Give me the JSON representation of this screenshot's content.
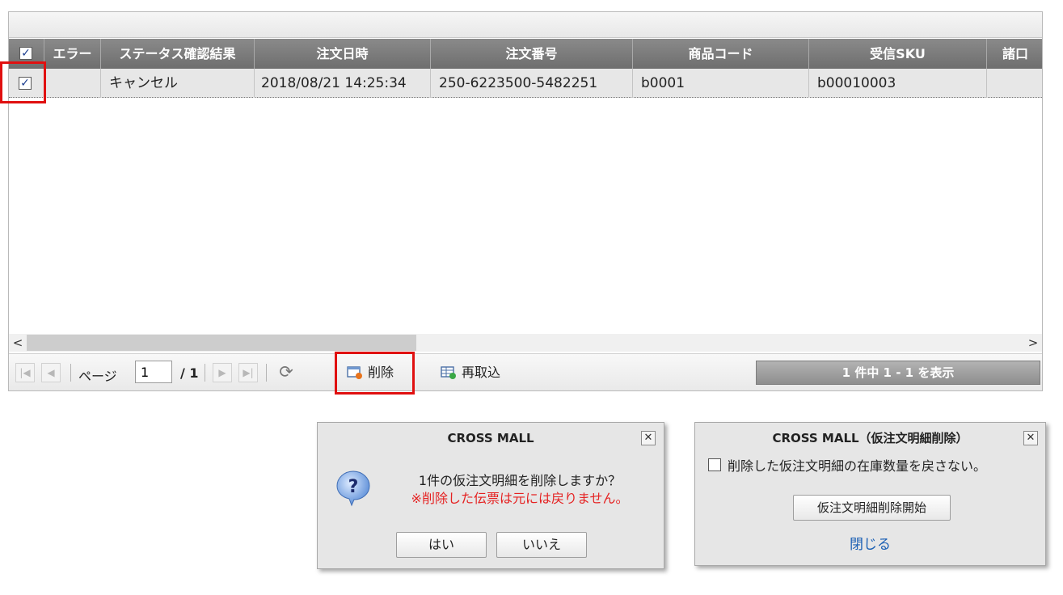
{
  "grid": {
    "columns": [
      {
        "label": ""
      },
      {
        "label": "エラー"
      },
      {
        "label": "ステータス確認結果"
      },
      {
        "label": "注文日時"
      },
      {
        "label": "注文番号"
      },
      {
        "label": "商品コード"
      },
      {
        "label": "受信SKU"
      },
      {
        "label": "諸口"
      }
    ],
    "header_checkbox": "✓",
    "rows": [
      {
        "checkbox": "✓",
        "error": "",
        "status": "キャンセル",
        "order_datetime": "2018/08/21 14:25:34",
        "order_number": "250-6223500-5482251",
        "product_code": "b0001",
        "received_sku": "b00010003",
        "misc": ""
      }
    ],
    "scroll_left": "<",
    "scroll_right": ">"
  },
  "toolbar": {
    "page_label": "ページ",
    "page_value": "1",
    "page_total": "/ 1",
    "delete_label": "削除",
    "reimport_label": "再取込",
    "status_text": "1 件中 1 - 1 を表示"
  },
  "confirm_dialog": {
    "title": "CROSS MALL",
    "close": "✕",
    "icon": "question-icon",
    "message": "1件の仮注文明細を削除しますか？",
    "warning": "※削除した伝票は元には戻りません。",
    "yes": "はい",
    "no": "いいえ"
  },
  "delete_dialog": {
    "title": "CROSS MALL（仮注文明細削除）",
    "close": "✕",
    "checkbox_label": "削除した仮注文明細の在庫数量を戻さない。",
    "start_button": "仮注文明細削除開始",
    "close_link": "閉じる"
  },
  "colors": {
    "header_bg": "#7d7d7d",
    "row_bg": "#e7e7e7",
    "highlight": "#e01010",
    "warning_text": "#e52222",
    "link": "#1a5fb4"
  }
}
